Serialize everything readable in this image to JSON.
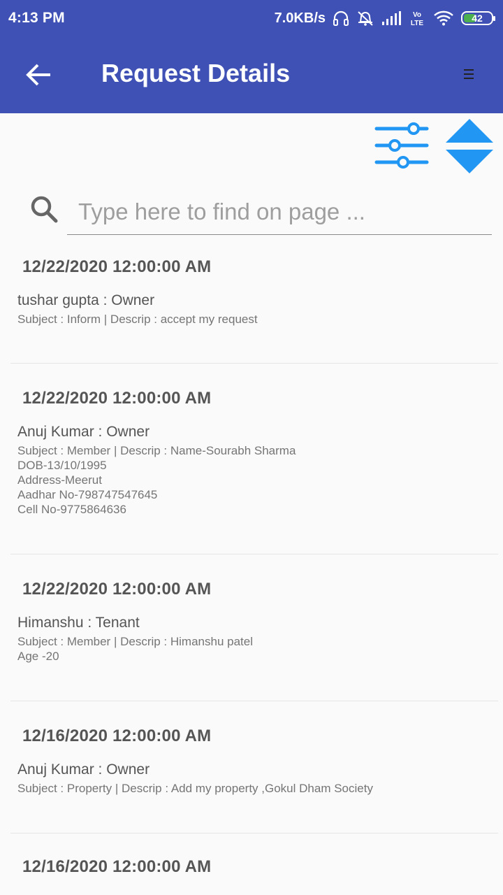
{
  "status_bar": {
    "time": "4:13 PM",
    "network_speed": "7.0KB/s",
    "battery_level": "42",
    "icons": [
      "headphones-icon",
      "alarm-off-icon",
      "signal-icon",
      "volte-icon",
      "wifi-icon",
      "battery-icon"
    ],
    "volte_label": "Vo LTE"
  },
  "app_bar": {
    "title": "Request Details",
    "back_icon": "arrow-back-icon",
    "menu_icon": "hamburger-menu-icon",
    "color": "#3f51b5"
  },
  "toolbar": {
    "filter_icon": "sliders-filter-icon",
    "sort_icon": "sort-up-down-icon",
    "accent": "#2196f3"
  },
  "search": {
    "placeholder": "Type here to find on page ...",
    "value": "",
    "icon": "search-icon"
  },
  "requests": [
    {
      "date": "12/22/2020 12:00:00 AM",
      "name": "tushar gupta  : Owner",
      "description": "Subject : Inform | Descrip : accept my request"
    },
    {
      "date": "12/22/2020 12:00:00 AM",
      "name": "Anuj Kumar : Owner",
      "description": "Subject : Member | Descrip : Name-Sourabh Sharma\nDOB-13/10/1995\nAddress-Meerut\nAadhar No-798747547645\nCell No-9775864636"
    },
    {
      "date": "12/22/2020 12:00:00 AM",
      "name": "Himanshu  : Tenant",
      "description": "Subject : Member | Descrip : Himanshu patel\nAge -20"
    },
    {
      "date": "12/16/2020 12:00:00 AM",
      "name": "Anuj Kumar : Owner",
      "description": "Subject : Property | Descrip : Add my property ,Gokul Dham Society"
    },
    {
      "date": "12/16/2020 12:00:00 AM",
      "name": "",
      "description": ""
    }
  ]
}
